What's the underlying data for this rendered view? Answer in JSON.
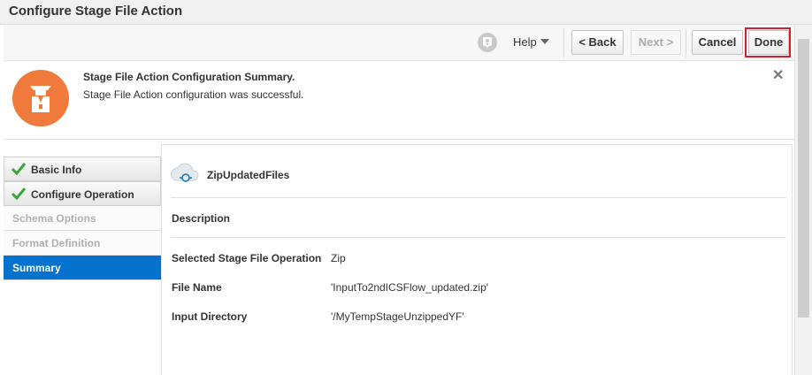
{
  "window": {
    "title": "Configure Stage File Action"
  },
  "toolbar": {
    "help_label": "Help",
    "back_label": "< Back",
    "next_label": "Next >",
    "cancel_label": "Cancel",
    "done_label": "Done"
  },
  "banner": {
    "title": "Stage File Action Configuration Summary.",
    "message": "Stage File Action configuration was successful.",
    "close_glyph": "✕"
  },
  "train": {
    "steps": [
      {
        "label": "Basic Info",
        "state": "completed"
      },
      {
        "label": "Configure Operation",
        "state": "completed"
      },
      {
        "label": "Schema Options",
        "state": "disabled"
      },
      {
        "label": "Format Definition",
        "state": "disabled"
      },
      {
        "label": "Summary",
        "state": "active"
      }
    ]
  },
  "summary": {
    "action_name": "ZipUpdatedFiles",
    "description_label": "Description",
    "rows": [
      {
        "label": "Selected Stage File Operation",
        "value": "Zip"
      },
      {
        "label": "File Name",
        "value": "'InputTo2ndICSFlow_updated.zip'"
      },
      {
        "label": "Input Directory",
        "value": "'/MyTempStageUnzippedYF'"
      }
    ]
  },
  "colors": {
    "accent_blue": "#0572ce",
    "banner_icon_orange": "#ef7a3b",
    "check_green": "#3aa63a",
    "done_highlight_red": "#d2202a"
  },
  "icons": {
    "help": "help-bubble-icon",
    "banner": "stage-file-action-icon",
    "close": "close-icon",
    "check": "checkmark-icon",
    "cloud": "cloud-connection-icon"
  }
}
